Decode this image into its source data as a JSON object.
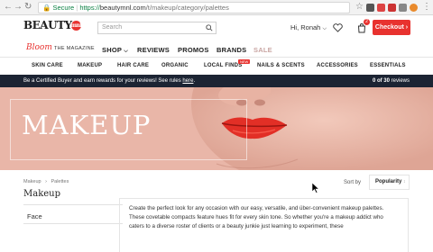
{
  "browser": {
    "secure_label": "Secure",
    "url_protocol": "https://",
    "url_host": "beautymnl.com",
    "url_path": "/t/makeup/category/palettes"
  },
  "header": {
    "logo_text": "BEAUTY",
    "logo_badge": "mnl",
    "search_placeholder": "Search",
    "greeting": "Hi, Ronah",
    "cart_count": "2",
    "checkout_label": "Checkout"
  },
  "main_nav": {
    "bloom": "Bloom",
    "magazine": "THE MAGAZINE",
    "items": [
      "SHOP",
      "REVIEWS",
      "PROMOS",
      "BRANDS",
      "SALE"
    ]
  },
  "categories": {
    "items": [
      "SKIN CARE",
      "MAKEUP",
      "HAIR CARE",
      "ORGANIC",
      "LOCAL FINDS",
      "NAILS & SCENTS",
      "ACCESSORIES",
      "ESSENTIALS"
    ],
    "new_badge": "NEW"
  },
  "promo": {
    "text": "Be a Certified Buyer and earn rewards for your reviews! See rules",
    "link": "here",
    "count_bold": "0 of 30",
    "count_suffix": "reviews"
  },
  "hero": {
    "title": "MAKEUP"
  },
  "content": {
    "breadcrumb_1": "Makeup",
    "breadcrumb_2": "Palettes",
    "heading": "Makeup",
    "face_label": "Face",
    "sort_label": "Sort by",
    "sort_value": "Popularity",
    "description": "Create the perfect look for any occasion with our easy, versatile, and über-convenient makeup palettes. These covetable compacts feature hues fit for every skin tone. So whether you're a makeup addict who caters to a diverse roster of clients or a beauty junkie just learning to experiment, these"
  }
}
